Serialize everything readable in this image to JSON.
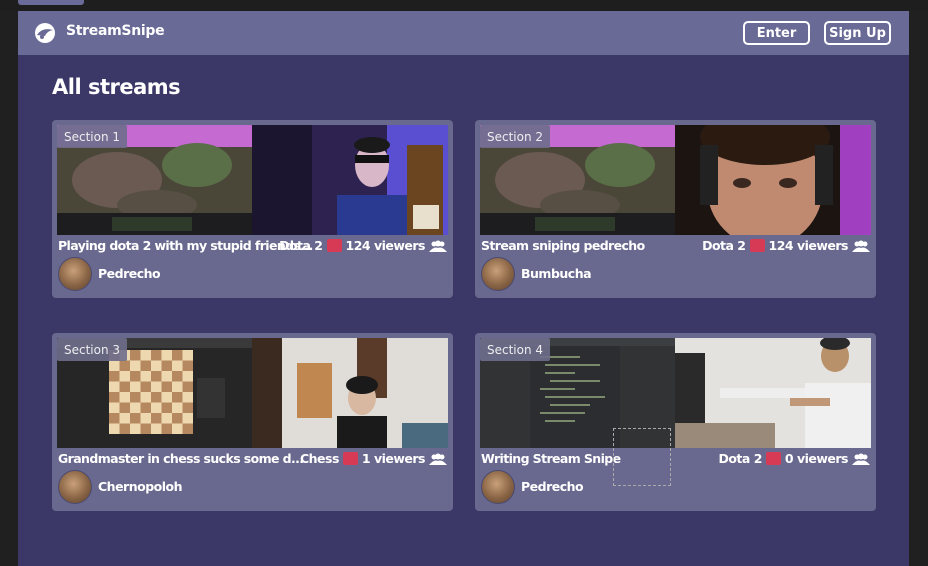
{
  "header": {
    "brand": "StreamSnipe",
    "enter_label": "Enter",
    "signup_label": "Sign Up"
  },
  "page": {
    "title": "All streams"
  },
  "cards": [
    {
      "section": "Section 1",
      "title": "Playing dota 2 with my stupid friends...",
      "game": "Dota 2",
      "viewers": "124 viewers",
      "streamer": "Pedrecho"
    },
    {
      "section": "Section 2",
      "title": "Stream sniping pedrecho",
      "game": "Dota 2",
      "viewers": "124 viewers",
      "streamer": "Bumbucha"
    },
    {
      "section": "Section 3",
      "title": "Grandmaster in chess sucks some d...",
      "game": "Chess",
      "viewers": "1 viewers",
      "streamer": "Chernopoloh"
    },
    {
      "section": "Section 4",
      "title": "Writing Stream Snipe",
      "game": "Dota 2",
      "viewers": "0 viewers",
      "streamer": "Pedrecho"
    }
  ],
  "colors": {
    "background": "#3b3868",
    "header": "#6a6a96",
    "card": "#69698f",
    "game_badge": "#d63a55"
  }
}
